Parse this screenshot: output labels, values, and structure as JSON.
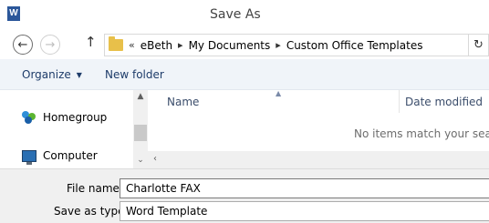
{
  "window": {
    "title": "Save As",
    "app_icon": "W"
  },
  "navigation": {
    "back_icon": "back-arrow-icon",
    "forward_icon": "forward-arrow-icon",
    "up_icon": "up-arrow-icon",
    "overflow": "«",
    "breadcrumbs": [
      "eBeth",
      "My Documents",
      "Custom Office Templates"
    ],
    "refresh_icon": "refresh-icon"
  },
  "toolbar": {
    "organize_label": "Organize",
    "new_folder_label": "New folder"
  },
  "nav_pane": {
    "items": [
      {
        "label": "Homegroup",
        "icon": "homegroup-icon"
      },
      {
        "label": "Computer",
        "icon": "computer-icon"
      }
    ]
  },
  "file_list": {
    "columns": [
      "Name",
      "Date modified"
    ],
    "empty_message": "No items match your search."
  },
  "form": {
    "file_name_label": "File name:",
    "file_name_value": "Charlotte FAX",
    "save_type_label": "Save as type:",
    "save_type_value": "Word Template"
  },
  "colors": {
    "accent": "#2b579a",
    "toolbar_bg": "#f0f4f9",
    "header_text": "#3b4d6b"
  }
}
